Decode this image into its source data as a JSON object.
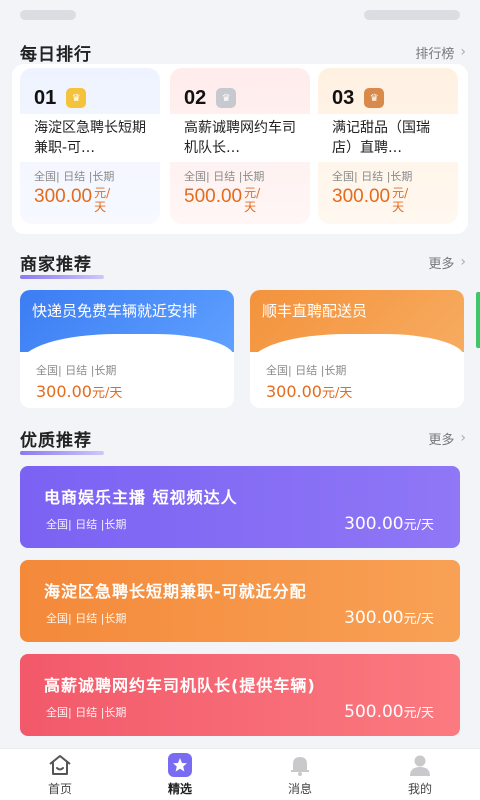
{
  "sections": {
    "daily_rank": {
      "title": "每日排行",
      "more": "排行榜"
    },
    "merchant": {
      "title": "商家推荐",
      "more": "更多"
    },
    "quality": {
      "title": "优质推荐",
      "more": "更多"
    }
  },
  "rank_items": [
    {
      "no": "01",
      "title": "海淀区急聘长短期兼职-可…",
      "tags": "全国| 日结 |长期",
      "price": "300.00",
      "unit": "元/天",
      "medal": "gold"
    },
    {
      "no": "02",
      "title": "高薪诚聘网约车司机队长…",
      "tags": "全国| 日结 |长期",
      "price": "500.00",
      "unit": "元/天",
      "medal": "silver"
    },
    {
      "no": "03",
      "title": "满记甜品（国瑞店）直聘…",
      "tags": "全国| 日结 |长期",
      "price": "300.00",
      "unit": "元/天",
      "medal": "bronze"
    }
  ],
  "merchant_items": [
    {
      "title": "快递员免费车辆就近安排",
      "tags": "全国| 日结 |长期",
      "price": "300.00",
      "unit": "元/天"
    },
    {
      "title": "顺丰直聘配送员",
      "tags": "全国| 日结 |长期",
      "price": "300.00",
      "unit": "元/天"
    }
  ],
  "quality_items": [
    {
      "title": "电商娱乐主播 短视频达人",
      "tags": "全国| 日结 |长期",
      "price": "300.00",
      "unit": "元/天"
    },
    {
      "title": "海淀区急聘长短期兼职-可就近分配",
      "tags": "全国| 日结 |长期",
      "price": "300.00",
      "unit": "元/天"
    },
    {
      "title": "高薪诚聘网约车司机队长(提供车辆)",
      "tags": "全国| 日结 |长期",
      "price": "500.00",
      "unit": "元/天"
    }
  ],
  "nav": [
    {
      "label": "首页",
      "icon": "home-icon"
    },
    {
      "label": "精选",
      "icon": "star-icon"
    },
    {
      "label": "消息",
      "icon": "bell-icon"
    },
    {
      "label": "我的",
      "icon": "user-icon"
    }
  ],
  "colors": {
    "price": "#e46a1c",
    "merchant_blue": "#3b7df3",
    "merchant_orange": "#f3923c",
    "banner_purple": "#7b62f3",
    "banner_orange": "#f4893a",
    "banner_red": "#f2596a",
    "accent": "#7a63f0"
  }
}
